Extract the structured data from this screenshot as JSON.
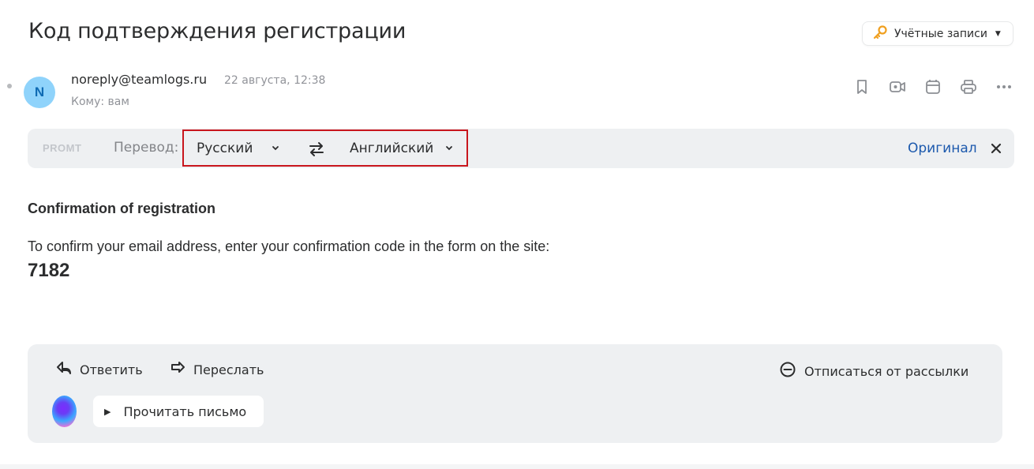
{
  "header": {
    "subject": "Код подтверждения регистрации",
    "accounts_label": "Учётные записи"
  },
  "message": {
    "avatar_letter": "N",
    "sender": "noreply@teamlogs.ru",
    "date": "22 августа, 12:38",
    "to": "Кому: вам",
    "actions": [
      "bookmark-icon",
      "video-call-icon",
      "calendar-icon",
      "print-icon",
      "more-icon"
    ]
  },
  "translate": {
    "brand": "PROMT",
    "label": "Перевод:",
    "from_lang": "Русский",
    "to_lang": "Английский",
    "original": "Оригинал"
  },
  "body": {
    "title": "Confirmation of registration",
    "text": "To confirm your email address, enter your confirmation code in the form on the site:",
    "code": "7182"
  },
  "footer": {
    "reply": "Ответить",
    "forward": "Переслать",
    "unsubscribe": "Отписаться от рассылки",
    "read_aloud": "Прочитать письмо"
  },
  "colors": {
    "accent_link": "#1c59ad",
    "highlight_border": "#c8161d",
    "key_icon": "#f0a020",
    "avatar_bg": "#8fd3fb"
  }
}
